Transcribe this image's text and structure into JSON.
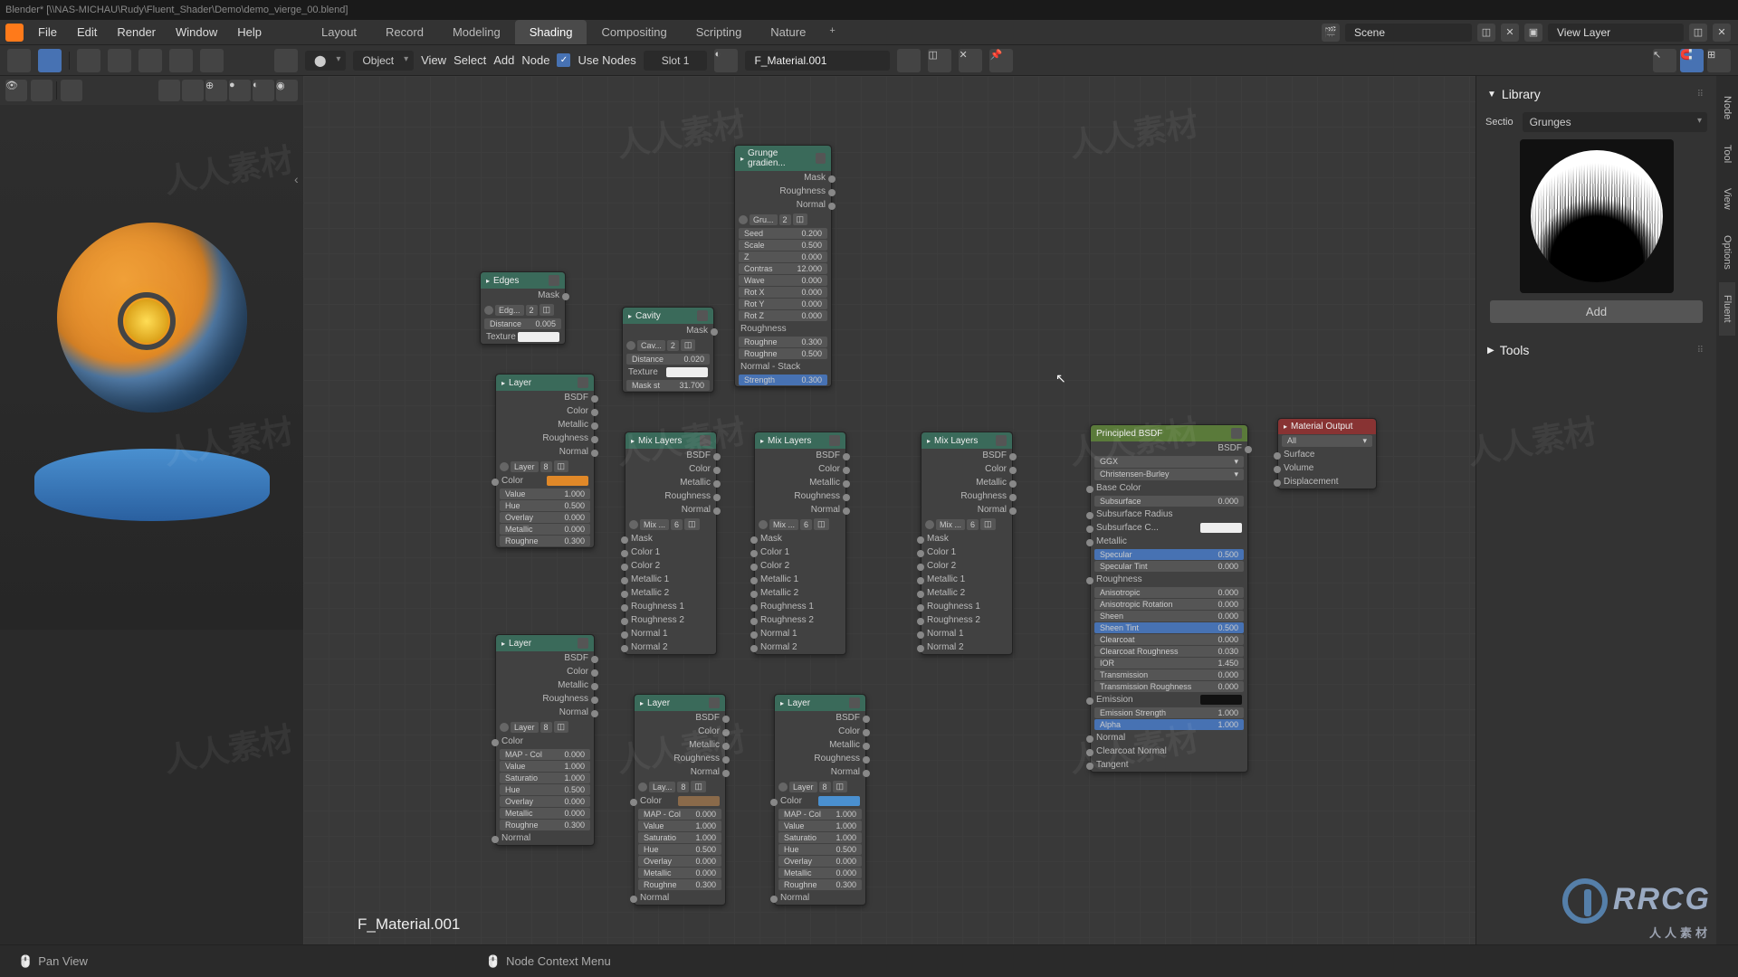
{
  "titlebar": "Blender* [\\\\NAS-MICHAU\\Rudy\\Fluent_Shader\\Demo\\demo_vierge_00.blend]",
  "menu": {
    "file": "File",
    "edit": "Edit",
    "render": "Render",
    "window": "Window",
    "help": "Help"
  },
  "workspaces": [
    "Layout",
    "Record",
    "Modeling",
    "Shading",
    "Compositing",
    "Scripting",
    "Nature"
  ],
  "ws_active": 3,
  "header": {
    "scene": "Scene",
    "viewlayer": "View Layer"
  },
  "toolbar": {
    "mode": "Object",
    "view": "View",
    "select": "Select",
    "add": "Add",
    "node": "Node",
    "use_nodes": "Use Nodes",
    "slot": "Slot 1",
    "material": "F_Material.001"
  },
  "material_float": "F_Material.001",
  "status": {
    "ctx": "Node Context Menu",
    "pan": "Pan View"
  },
  "rside": {
    "library": "Library",
    "section_label": "Sectio",
    "section_value": "Grunges",
    "add": "Add",
    "tools": "Tools"
  },
  "vtabs": [
    "Node",
    "Tool",
    "View",
    "Options",
    "Fluent"
  ],
  "nodes": {
    "edges": {
      "title": "Edges",
      "mask": "Mask",
      "btn": "Edg...",
      "n": "2",
      "distance": "Distance",
      "distance_v": "0.005",
      "texture": "Texture"
    },
    "cavity": {
      "title": "Cavity",
      "mask": "Mask",
      "btn": "Cav...",
      "n": "2",
      "distance": "Distance",
      "distance_v": "0.020",
      "texture": "Texture",
      "maskst": "Mask st",
      "maskst_v": "31.700"
    },
    "grunge": {
      "title": "Grunge gradien...",
      "mask": "Mask",
      "rough": "Roughness",
      "normal": "Normal",
      "btn": "Gru...",
      "n": "2",
      "rows": [
        [
          "Seed",
          "0.200"
        ],
        [
          "Scale",
          "0.500"
        ],
        [
          "Z",
          "0.000"
        ],
        [
          "Contras",
          "12.000"
        ],
        [
          "Wave",
          "0.000"
        ],
        [
          "Rot X",
          "0.000"
        ],
        [
          "Rot Y",
          "0.000"
        ],
        [
          "Rot Z",
          "0.000"
        ]
      ],
      "roughness": "Roughness",
      "roughne": "Roughne",
      "roughne_v": "0.300",
      "roughne2": "Roughne",
      "roughne2_v": "0.500",
      "normalstack": "Normal - Stack",
      "strength": "Strength",
      "strength_v": "0.300"
    },
    "layer1": {
      "title": "Layer",
      "outs": [
        "BSDF",
        "Color",
        "Metallic",
        "Roughness",
        "Normal"
      ],
      "btn": "Layer",
      "bn": "8",
      "color": "Color",
      "rows": [
        [
          "Value",
          "1.000"
        ],
        [
          "Hue",
          "0.500"
        ],
        [
          "Overlay",
          "0.000"
        ],
        [
          "Metallic",
          "0.000"
        ],
        [
          "Roughne",
          "0.300"
        ]
      ]
    },
    "layer2": {
      "title": "Layer",
      "outs": [
        "BSDF",
        "Color",
        "Metallic",
        "Roughness",
        "Normal"
      ],
      "btn": "Layer",
      "bn": "8",
      "color": "Color",
      "rows": [
        [
          "MAP - Col",
          "0.000"
        ],
        [
          "Value",
          "1.000"
        ],
        [
          "Saturatio",
          "1.000"
        ],
        [
          "Hue",
          "0.500"
        ],
        [
          "Overlay",
          "0.000"
        ],
        [
          "Metallic",
          "0.000"
        ],
        [
          "Roughne",
          "0.300"
        ]
      ],
      "normal": "Normal"
    },
    "layer3": {
      "title": "Layer",
      "outs": [
        "BSDF",
        "Color",
        "Metallic",
        "Roughness",
        "Normal"
      ],
      "btn": "Lay...",
      "bn": "8",
      "color": "Color",
      "rows": [
        [
          "MAP - Col",
          "0.000"
        ],
        [
          "Value",
          "1.000"
        ],
        [
          "Saturatio",
          "1.000"
        ],
        [
          "Hue",
          "0.500"
        ],
        [
          "Overlay",
          "0.000"
        ],
        [
          "Metallic",
          "0.000"
        ],
        [
          "Roughne",
          "0.300"
        ]
      ],
      "normal": "Normal"
    },
    "layer4": {
      "title": "Layer",
      "outs": [
        "BSDF",
        "Color",
        "Metallic",
        "Roughness",
        "Normal"
      ],
      "btn": "Layer",
      "bn": "8",
      "color": "Color",
      "rows": [
        [
          "MAP - Col",
          "1.000"
        ],
        [
          "Value",
          "1.000"
        ],
        [
          "Saturatio",
          "1.000"
        ],
        [
          "Hue",
          "0.500"
        ],
        [
          "Overlay",
          "0.000"
        ],
        [
          "Metallic",
          "0.000"
        ],
        [
          "Roughne",
          "0.300"
        ]
      ],
      "normal": "Normal"
    },
    "mix1": {
      "title": "Mix Layers",
      "outs": [
        "BSDF",
        "Color",
        "Metallic",
        "Roughness",
        "Normal"
      ],
      "btn": "Mix ...",
      "bn": "6",
      "ins": [
        "Mask",
        "Color 1",
        "Color 2",
        "Metallic 1",
        "Metallic 2",
        "Roughness 1",
        "Roughness 2",
        "Normal 1",
        "Normal 2"
      ]
    },
    "mix2": {
      "title": "Mix Layers",
      "outs": [
        "BSDF",
        "Color",
        "Metallic",
        "Roughness",
        "Normal"
      ],
      "btn": "Mix ...",
      "bn": "6",
      "ins": [
        "Mask",
        "Color 1",
        "Color 2",
        "Metallic 1",
        "Metallic 2",
        "Roughness 1",
        "Roughness 2",
        "Normal 1",
        "Normal 2"
      ]
    },
    "mix3": {
      "title": "Mix Layers",
      "outs": [
        "BSDF",
        "Color",
        "Metallic",
        "Roughness",
        "Normal"
      ],
      "btn": "Mix ...",
      "bn": "6",
      "ins": [
        "Mask",
        "Color 1",
        "Color 2",
        "Metallic 1",
        "Metallic 2",
        "Roughness 1",
        "Roughness 2",
        "Normal 1",
        "Normal 2"
      ]
    },
    "bsdf": {
      "title": "Principled BSDF",
      "out": "BSDF",
      "dist": "GGX",
      "sss": "Christensen-Burley",
      "rows": [
        [
          "Base Color",
          ""
        ],
        [
          "Subsurface",
          "0.000"
        ],
        [
          "Subsurface Radius",
          ""
        ],
        [
          "Subsurface C...",
          ""
        ],
        [
          "Metallic",
          ""
        ],
        [
          "Specular",
          "0.500"
        ],
        [
          "Specular Tint",
          "0.000"
        ],
        [
          "Roughness",
          ""
        ],
        [
          "Anisotropic",
          "0.000"
        ],
        [
          "Anisotropic Rotation",
          "0.000"
        ],
        [
          "Sheen",
          "0.000"
        ],
        [
          "Sheen Tint",
          "0.500"
        ],
        [
          "Clearcoat",
          "0.000"
        ],
        [
          "Clearcoat Roughness",
          "0.030"
        ],
        [
          "IOR",
          "1.450"
        ],
        [
          "Transmission",
          "0.000"
        ],
        [
          "Transmission Roughness",
          "0.000"
        ],
        [
          "Emission",
          ""
        ],
        [
          "Emission Strength",
          "1.000"
        ],
        [
          "Alpha",
          "1.000"
        ],
        [
          "Normal",
          ""
        ],
        [
          "Clearcoat Normal",
          ""
        ],
        [
          "Tangent",
          ""
        ]
      ]
    },
    "matout": {
      "title": "Material Output",
      "all": "All",
      "ins": [
        "Surface",
        "Volume",
        "Displacement"
      ]
    }
  }
}
